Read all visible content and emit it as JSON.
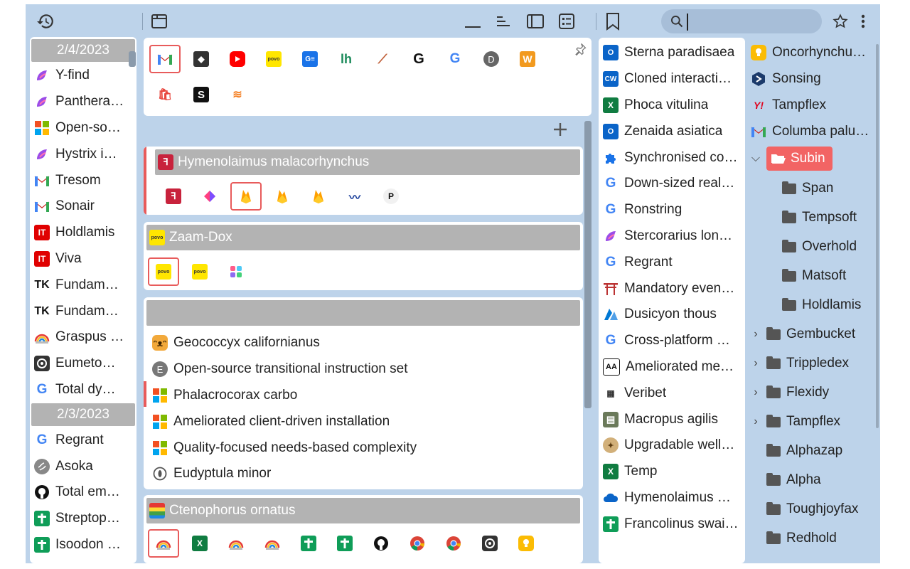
{
  "history": {
    "date1": "2/4/2023",
    "date2": "2/3/2023",
    "items1": [
      {
        "label": "Y-find",
        "icon": "purple-gradient"
      },
      {
        "label": "Panthera…",
        "icon": "purple-gradient"
      },
      {
        "label": "Open-so…",
        "icon": "microsoft"
      },
      {
        "label": "Hystrix i…",
        "icon": "purple-gradient"
      },
      {
        "label": "Tresom",
        "icon": "gmail"
      },
      {
        "label": "Sonair",
        "icon": "gmail"
      },
      {
        "label": "Holdlamis",
        "icon": "it-red"
      },
      {
        "label": "Viva",
        "icon": "it-red"
      },
      {
        "label": "Fundam…",
        "icon": "tk"
      },
      {
        "label": "Fundam…",
        "icon": "tk"
      },
      {
        "label": "Graspus …",
        "icon": "rainbow"
      },
      {
        "label": "Eumeto…",
        "icon": "dark-circle"
      },
      {
        "label": "Total dy…",
        "icon": "google"
      }
    ],
    "items2": [
      {
        "label": "Regrant",
        "icon": "google"
      },
      {
        "label": "Asoka",
        "icon": "grey-globe"
      },
      {
        "label": "Total em…",
        "icon": "github"
      },
      {
        "label": "Streptop…",
        "icon": "green-cross"
      },
      {
        "label": "Isoodon …",
        "icon": "green-cross"
      }
    ]
  },
  "groups": {
    "group1": {
      "title": "Hymenolaimus malacorhynchus"
    },
    "group2": {
      "title": "Zaam-Dox"
    },
    "group3": {
      "title": "",
      "items": [
        {
          "label": "Geococcyx californianus",
          "icon": "cat"
        },
        {
          "label": "Open-source transitional instruction set",
          "icon": "letter-e"
        },
        {
          "label": "Phalacrocorax carbo",
          "icon": "microsoft"
        },
        {
          "label": "Ameliorated client-driven installation",
          "icon": "microsoft"
        },
        {
          "label": "Quality-focused needs-based complexity",
          "icon": "microsoft"
        },
        {
          "label": "Eudyptula minor",
          "icon": "feather-circle"
        }
      ]
    },
    "group4": {
      "title": "Ctenophorus ornatus"
    }
  },
  "bookmarks": [
    {
      "label": "Sterna paradisaea",
      "icon": "outlook"
    },
    {
      "label": "Cloned interacti…",
      "icon": "cw"
    },
    {
      "label": "Phoca vitulina",
      "icon": "excel"
    },
    {
      "label": "Zenaida asiatica",
      "icon": "outlook"
    },
    {
      "label": "Synchronised co…",
      "icon": "puzzle"
    },
    {
      "label": "Down-sized real…",
      "icon": "google"
    },
    {
      "label": "Ronstring",
      "icon": "google"
    },
    {
      "label": "Stercorarius lon…",
      "icon": "purple-gradient"
    },
    {
      "label": "Regrant",
      "icon": "google"
    },
    {
      "label": "Mandatory even…",
      "icon": "torii"
    },
    {
      "label": "Dusicyon thous",
      "icon": "azure"
    },
    {
      "label": "Cross-platform …",
      "icon": "google"
    },
    {
      "label": "Ameliorated me…",
      "icon": "bw-logo"
    },
    {
      "label": "Veribet",
      "icon": "grid-logo"
    },
    {
      "label": "Macropus agilis",
      "icon": "book"
    },
    {
      "label": "Upgradable well…",
      "icon": "badge"
    },
    {
      "label": "Temp",
      "icon": "excel"
    },
    {
      "label": "Hymenolaimus …",
      "icon": "onedrive"
    },
    {
      "label": "Francolinus swai…",
      "icon": "green-cross"
    }
  ],
  "tree": {
    "top": [
      {
        "label": "Oncorhynchu…",
        "icon": "bulb"
      },
      {
        "label": "Sonsing",
        "icon": "hex-blue"
      },
      {
        "label": "Tampflex",
        "icon": "yahoo"
      },
      {
        "label": "Columba palu…",
        "icon": "gmail"
      }
    ],
    "open_folder": "Subin",
    "children": [
      "Span",
      "Tempsoft",
      "Overhold",
      "Matsoft",
      "Holdlamis"
    ],
    "collapsed": [
      "Gembucket",
      "Trippledex",
      "Flexidy",
      "Tampflex"
    ],
    "plain": [
      "Alphazap",
      "Alpha",
      "Toughjoyfax",
      "Redhold"
    ]
  },
  "colors": {
    "accent": "#e85b5b",
    "panel_bg": "#bdd3ea",
    "header_grey": "#b3b3b3"
  }
}
